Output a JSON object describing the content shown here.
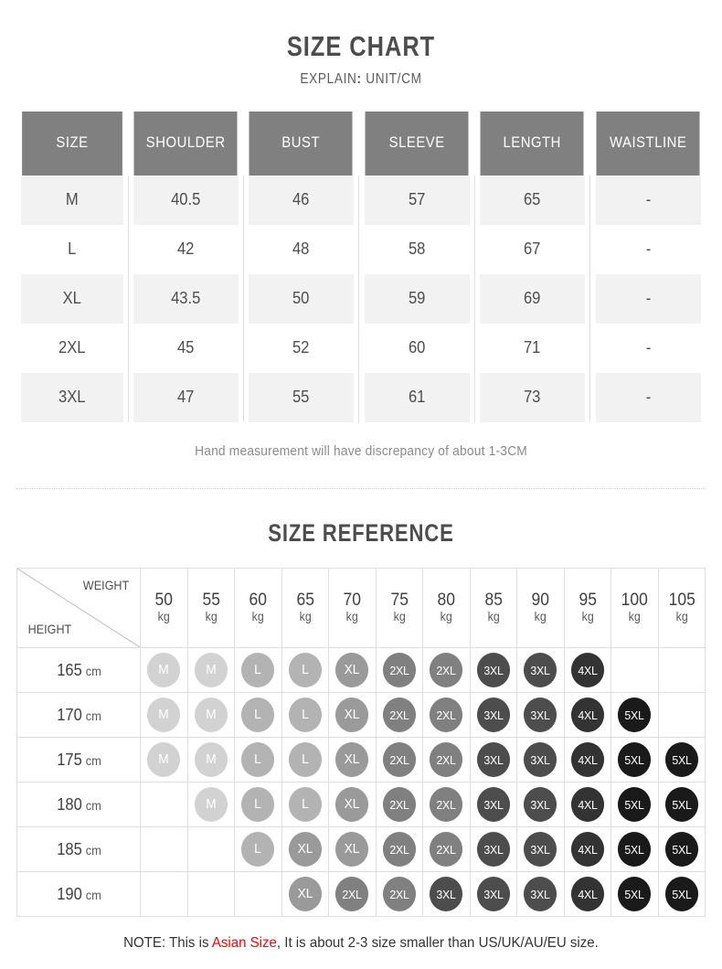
{
  "section1": {
    "title": "SIZE CHART",
    "subtitle_prefix": "EXPLAIN",
    "subtitle_colon": ":",
    "subtitle_value": "UNIT/CM",
    "footnote": "Hand measurement will have discrepancy of about 1-3CM",
    "table": {
      "headers": [
        "SIZE",
        "SHOULDER",
        "BUST",
        "SLEEVE",
        "LENGTH",
        "WAISTLINE"
      ],
      "rows": [
        [
          "M",
          "40.5",
          "46",
          "57",
          "65",
          "-"
        ],
        [
          "L",
          "42",
          "48",
          "58",
          "67",
          "-"
        ],
        [
          "XL",
          "43.5",
          "50",
          "59",
          "69",
          "-"
        ],
        [
          "2XL",
          "45",
          "52",
          "60",
          "71",
          "-"
        ],
        [
          "3XL",
          "47",
          "55",
          "61",
          "73",
          "-"
        ]
      ]
    }
  },
  "section2": {
    "title": "SIZE REFERENCE",
    "corner": {
      "weight_label": "WEIGHT",
      "height_label": "HEIGHT"
    },
    "weight_unit": "kg",
    "height_unit": "cm",
    "weights": [
      "50",
      "55",
      "60",
      "65",
      "70",
      "75",
      "80",
      "85",
      "90",
      "95",
      "100",
      "105"
    ],
    "heights": [
      "165",
      "170",
      "175",
      "180",
      "185",
      "190"
    ],
    "grid": [
      [
        "M",
        "M",
        "L",
        "L",
        "XL",
        "2XL",
        "2XL",
        "3XL",
        "3XL",
        "4XL",
        "",
        ""
      ],
      [
        "M",
        "M",
        "L",
        "L",
        "XL",
        "2XL",
        "2XL",
        "3XL",
        "3XL",
        "4XL",
        "5XL",
        ""
      ],
      [
        "M",
        "M",
        "L",
        "L",
        "XL",
        "2XL",
        "2XL",
        "3XL",
        "3XL",
        "4XL",
        "5XL",
        "5XL"
      ],
      [
        "",
        "M",
        "L",
        "L",
        "XL",
        "2XL",
        "2XL",
        "3XL",
        "3XL",
        "4XL",
        "5XL",
        "5XL"
      ],
      [
        "",
        "",
        "L",
        "XL",
        "XL",
        "2XL",
        "2XL",
        "3XL",
        "3XL",
        "4XL",
        "5XL",
        "5XL"
      ],
      [
        "",
        "",
        "",
        "XL",
        "2XL",
        "2XL",
        "3XL",
        "3XL",
        "3XL",
        "4XL",
        "5XL",
        "5XL"
      ]
    ],
    "bubble_colors": {
      "M": "#d2d2d2",
      "L": "#b3b3b3",
      "XL": "#9a9a9a",
      "2XL": "#808080",
      "3XL": "#4d4d4d",
      "4XL": "#333333",
      "5XL": "#1a1a1a"
    }
  },
  "bottom_note": {
    "prefix": "NOTE: This is ",
    "highlight": "Asian Size",
    "suffix": ", It is about 2-3 size smaller than US/UK/AU/EU size."
  },
  "colors": {
    "header_gray": "#808080",
    "row_alt": "#f2f2f2",
    "accent_red": "#ff0000"
  }
}
